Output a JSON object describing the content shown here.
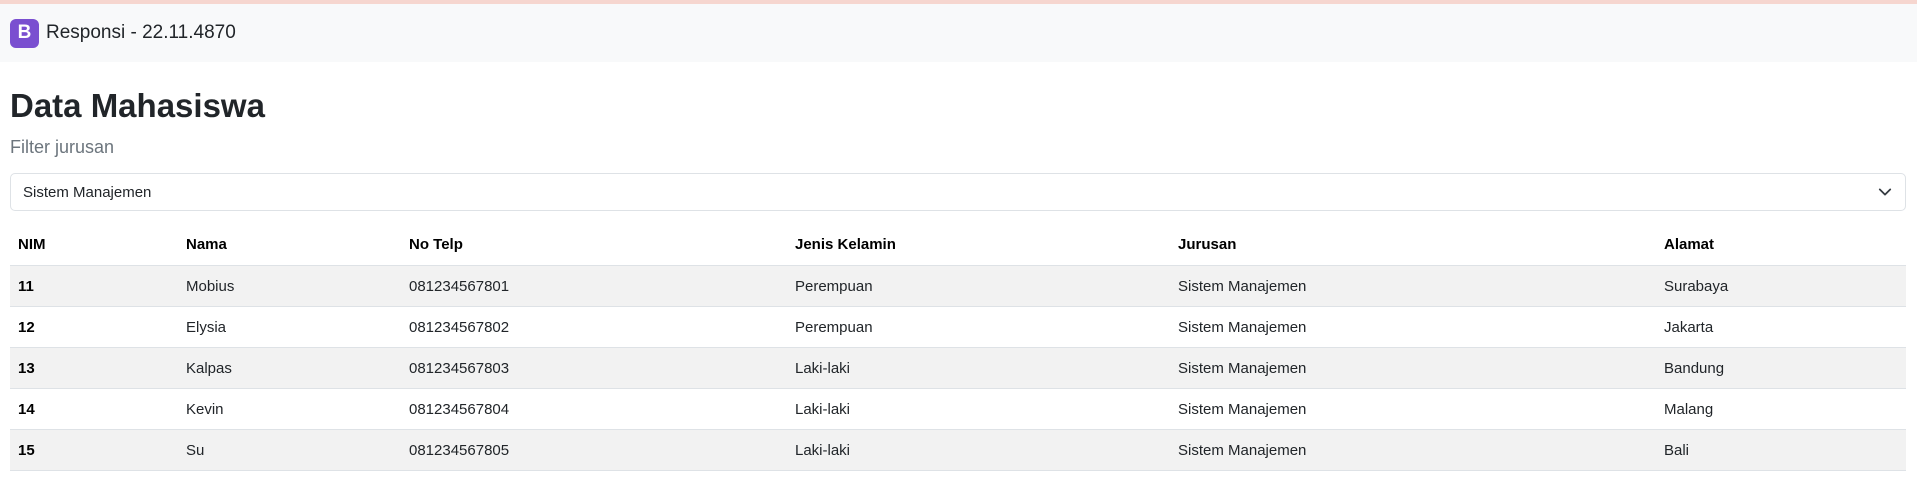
{
  "navbar": {
    "logo_letter": "B",
    "brand_title": "Responsi - 22.11.4870"
  },
  "page": {
    "title": "Data Mahasiswa",
    "filter_label": "Filter jurusan",
    "filter_selected": "Sistem Manajemen"
  },
  "table": {
    "headers": [
      "NIM",
      "Nama",
      "No Telp",
      "Jenis Kelamin",
      "Jurusan",
      "Alamat"
    ],
    "rows": [
      [
        "11",
        "Mobius",
        "081234567801",
        "Perempuan",
        "Sistem Manajemen",
        "Surabaya"
      ],
      [
        "12",
        "Elysia",
        "081234567802",
        "Perempuan",
        "Sistem Manajemen",
        "Jakarta"
      ],
      [
        "13",
        "Kalpas",
        "081234567803",
        "Laki-laki",
        "Sistem Manajemen",
        "Bandung"
      ],
      [
        "14",
        "Kevin",
        "081234567804",
        "Laki-laki",
        "Sistem Manajemen",
        "Malang"
      ],
      [
        "15",
        "Su",
        "081234567805",
        "Laki-laki",
        "Sistem Manajemen",
        "Bali"
      ]
    ]
  },
  "colors": {
    "brand": "#7a4fd0",
    "navbar_bg": "#f8f9fa",
    "stripe": "#f2f2f2"
  },
  "icons": {
    "logo": "bootstrap-logo-icon",
    "select_caret": "chevron-down-icon"
  }
}
